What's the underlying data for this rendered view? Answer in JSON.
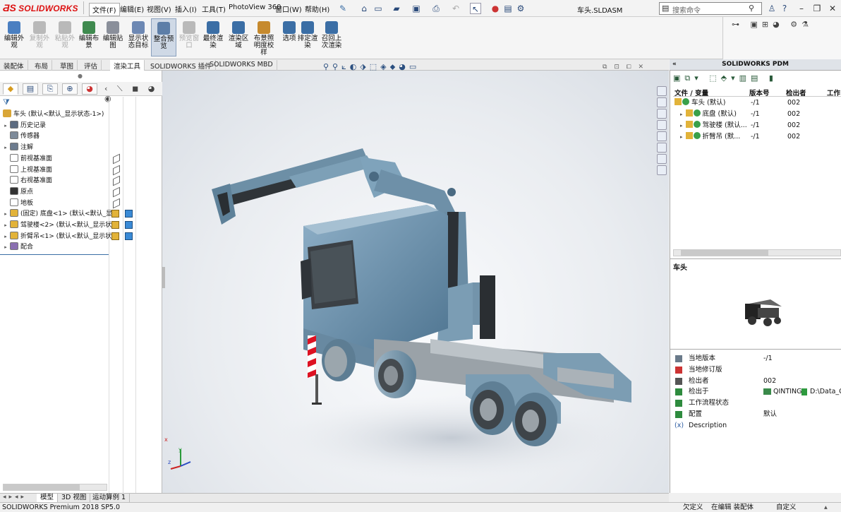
{
  "app": {
    "logo_text": "SOLIDWORKS",
    "document_title": "车头.SLDASM"
  },
  "menu": [
    "文件(F)",
    "编辑(E)",
    "视图(V)",
    "插入(I)",
    "工具(T)",
    "PhotoView 360",
    "窗口(W)",
    "帮助(H)"
  ],
  "search": {
    "placeholder": "搜索命令"
  },
  "ribbon": [
    {
      "label": "编辑外观",
      "state": "normal",
      "color": "#4a7fc1"
    },
    {
      "label": "复制外观",
      "state": "disabled",
      "color": "#b9b9b9"
    },
    {
      "label": "粘贴外观",
      "state": "disabled",
      "color": "#b9b9b9"
    },
    {
      "label": "编辑布景",
      "state": "normal",
      "color": "#3f8a4f"
    },
    {
      "label": "编辑贴图",
      "state": "normal",
      "color": "#8a8f9a"
    },
    {
      "label": "显示状态目标",
      "state": "normal",
      "color": "#6d88b3"
    },
    {
      "label": "整合预览",
      "state": "selected",
      "color": "#5d7ea8"
    },
    {
      "label": "预览窗口",
      "state": "disabled",
      "color": "#b9b9b9"
    },
    {
      "label": "最终渲染",
      "state": "normal",
      "color": "#3b6ea5"
    },
    {
      "label": "渲染区域",
      "state": "normal",
      "color": "#3b6ea5"
    },
    {
      "label": "布景照明度校样",
      "state": "normal",
      "color": "#c68a2e"
    },
    {
      "label": "选项",
      "state": "normal",
      "color": "#3b6ea5"
    },
    {
      "label": "排定渲染",
      "state": "normal",
      "color": "#3b6ea5"
    },
    {
      "label": "召回上次渲染",
      "state": "normal",
      "color": "#3b6ea5"
    }
  ],
  "command_tabs": [
    "装配体",
    "布局",
    "草图",
    "评估",
    "渲染工具",
    "SOLIDWORKS 插件",
    "SOLIDWORKS MBD"
  ],
  "active_command_tab": "渲染工具",
  "tree": {
    "root": "车头  (默认<默认_显示状态-1>)",
    "items": [
      {
        "label": "历史记录",
        "arrow": true,
        "icon": "history-icon"
      },
      {
        "label": "传感器",
        "arrow": false,
        "icon": "sensor-icon"
      },
      {
        "label": "注解",
        "arrow": true,
        "icon": "annotation-icon"
      },
      {
        "label": "前视基准面",
        "arrow": false,
        "icon": "plane-icon"
      },
      {
        "label": "上视基准面",
        "arrow": false,
        "icon": "plane-icon"
      },
      {
        "label": "右视基准面",
        "arrow": false,
        "icon": "plane-icon"
      },
      {
        "label": "原点",
        "arrow": false,
        "icon": "origin-icon"
      },
      {
        "label": "地板",
        "arrow": false,
        "icon": "plane-icon"
      },
      {
        "label": "(固定) 底盘<1> (默认<默认_显",
        "arrow": true,
        "icon": "part-icon"
      },
      {
        "label": "驾驶楼<2> (默认<默认_显示状",
        "arrow": true,
        "icon": "part-icon"
      },
      {
        "label": "折臂吊<1> (默认<默认_显示状",
        "arrow": true,
        "icon": "part-icon"
      },
      {
        "label": "配合",
        "arrow": true,
        "icon": "mates-icon"
      }
    ]
  },
  "pdm": {
    "title": "SOLIDWORKS PDM",
    "columns": [
      "文件 / 变量",
      "版本号",
      "检出者",
      "工作"
    ],
    "rows": [
      {
        "name": "车头  (默认)",
        "version": "-/1",
        "checked_out_by": "002",
        "indent": 0
      },
      {
        "name": "底盘  (默认)",
        "version": "-/1",
        "checked_out_by": "002",
        "indent": 1
      },
      {
        "name": "驾驶楼  (默认...",
        "version": "-/1",
        "checked_out_by": "002",
        "indent": 1
      },
      {
        "name": "折臂吊  (默...",
        "version": "-/1",
        "checked_out_by": "002",
        "indent": 1
      }
    ],
    "preview_title": "车头",
    "properties": [
      {
        "key": "当地版本",
        "value": "-/1"
      },
      {
        "key": "当地修订版",
        "value": ""
      },
      {
        "key": "检出者",
        "value": "002"
      },
      {
        "key": "检出于",
        "value": "QINTING",
        "value2": "D:\\Data_Ce"
      },
      {
        "key": "工作流程状态",
        "value": ""
      },
      {
        "key": "配置",
        "value": "默认"
      },
      {
        "key": "Description",
        "value": "",
        "prefix": "(x)"
      }
    ]
  },
  "bottom_tabs": [
    "模型",
    "3D 视图",
    "运动算例 1"
  ],
  "status": {
    "product": "SOLIDWORKS Premium 2018 SP5.0",
    "undefined": "欠定义",
    "editing": "在编辑 装配体",
    "custom": "自定义"
  },
  "axes": {
    "x": "x",
    "y": "y",
    "z": "z"
  }
}
